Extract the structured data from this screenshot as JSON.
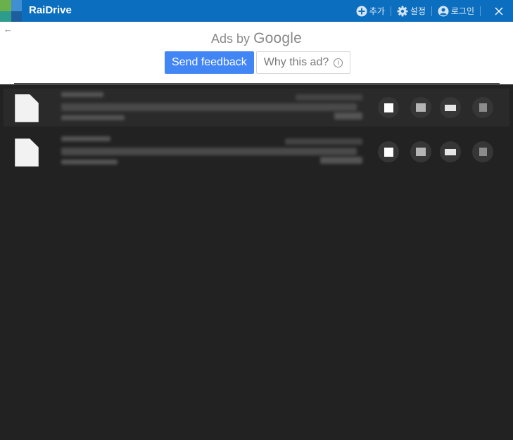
{
  "titlebar": {
    "app_name": "RaiDrive",
    "add_label": "추가",
    "settings_label": "설정",
    "login_label": "로그인",
    "close_icon": "close-icon",
    "colors": {
      "background": "#0c6ebf"
    }
  },
  "ad": {
    "back_icon": "←",
    "ads_by_prefix": "Ads by",
    "ads_by_brand": "Google",
    "send_feedback_label": "Send feedback",
    "why_this_ad_label": "Why this ad?",
    "info_glyph": "i",
    "colors": {
      "feedback_button": "#4285f4"
    }
  },
  "drives": {
    "colors": {
      "background": "#222222",
      "selected_row": "#2a2a2a"
    }
  }
}
